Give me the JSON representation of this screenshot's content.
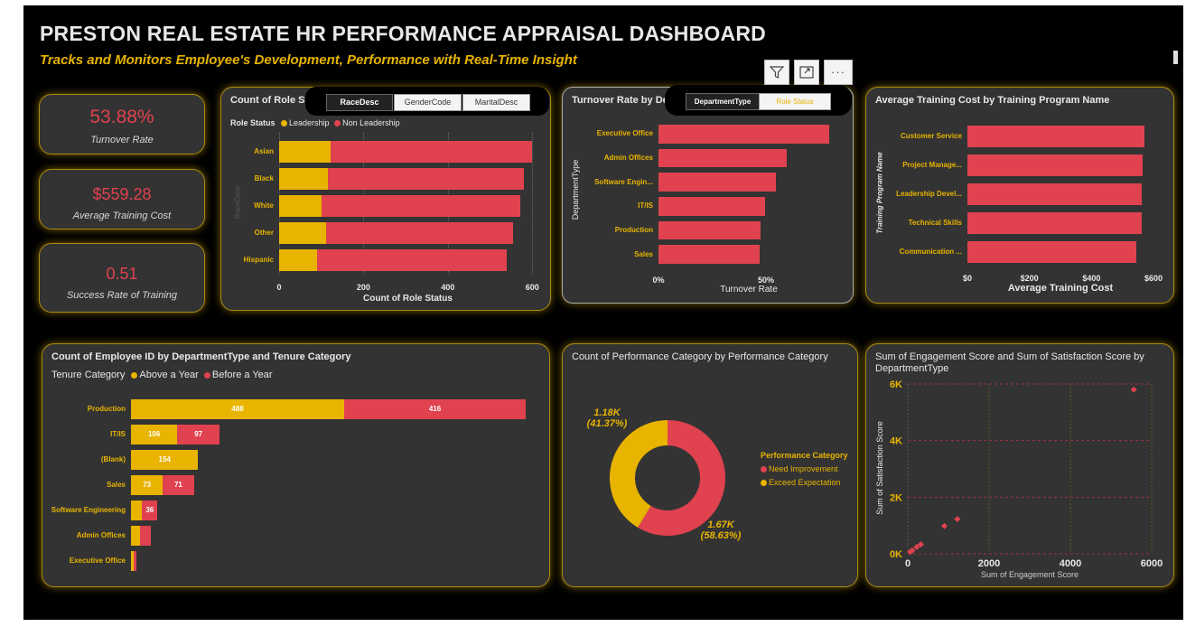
{
  "header": {
    "title": "PRESTON REAL ESTATE HR PERFORMANCE APPRAISAL DASHBOARD",
    "subtitle": "Tracks and Monitors Employee's Development, Performance  with Real-Time Insight"
  },
  "colors": {
    "gold": "#e8b400",
    "red": "#e0424f",
    "card": "#333333"
  },
  "kpis": [
    {
      "value": "53.88%",
      "label": "Turnover Rate"
    },
    {
      "value": "$559.28",
      "label": "Average Training Cost"
    },
    {
      "value": "0.51",
      "label": "Success Rate of Training"
    }
  ],
  "visual_header_icons": [
    "filter-icon",
    "focus-mode-icon",
    "more-options-icon"
  ],
  "more_options_glyph": "···",
  "chart_data": [
    {
      "id": "role_status",
      "type": "bar",
      "orientation": "horizontal",
      "stacked": true,
      "title": "Count of Role Status by RaceDesc",
      "title_visible": "Count of Role Stat",
      "legend_title": "Role Status",
      "tabs": [
        "RaceDesc",
        "GenderCode",
        "MaritalDesc"
      ],
      "ylabel": "RaceDesc",
      "xlabel": "Count of Role Status",
      "categories": [
        "Asian",
        "Black",
        "White",
        "Other",
        "Hispanic"
      ],
      "series": [
        {
          "name": "Leadership",
          "values": [
            123,
            116,
            101,
            112,
            90
          ]
        },
        {
          "name": "Non Leadership",
          "values": [
            477,
            464,
            470,
            442,
            449
          ]
        }
      ],
      "xticks": [
        "0",
        "200",
        "400",
        "600"
      ],
      "xlim": [
        0,
        610
      ]
    },
    {
      "id": "turnover",
      "type": "bar",
      "orientation": "horizontal",
      "title": "Turnover Rate by DepartmentType",
      "title_visible": "Turnover Rate by Dep",
      "tabs": [
        "DepartmentType",
        "Role Status"
      ],
      "ylabel": "DepartmentType",
      "xlabel": "Turnover Rate",
      "categories": [
        "Executive Office",
        "Admin Offices",
        "Software Engin...",
        "IT/IS",
        "Production",
        "Sales"
      ],
      "values": [
        0.795,
        0.595,
        0.545,
        0.495,
        0.475,
        0.47
      ],
      "xticks": [
        "0%",
        "50%"
      ],
      "xlim": [
        0,
        0.84
      ]
    },
    {
      "id": "training_cost",
      "type": "bar",
      "orientation": "horizontal",
      "title": "Average Training Cost by Training Program Name",
      "ylabel": "Training Program Name",
      "xlabel": "Average Training Cost",
      "categories": [
        "Customer Service",
        "Project Manage...",
        "Leadership Devel...",
        "Technical Skills",
        "Communication ..."
      ],
      "values": [
        571,
        564,
        562,
        562,
        546
      ],
      "xticks": [
        "$0",
        "$200",
        "$400",
        "$600"
      ],
      "xlim": [
        0,
        600
      ]
    },
    {
      "id": "tenure",
      "type": "bar",
      "orientation": "horizontal",
      "stacked": true,
      "title": "Count of Employee ID by DepartmentType and Tenure Category",
      "legend_title": "Tenure Category",
      "categories": [
        "Production",
        "IT/IS",
        "(Blank)",
        "Sales",
        "Software Engineering",
        "Admin Offices",
        "Executive Office"
      ],
      "series": [
        {
          "name": "Above a Year",
          "values": [
            488,
            106,
            154,
            73,
            25,
            20,
            6
          ]
        },
        {
          "name": "Before a Year",
          "values": [
            416,
            97,
            0,
            71,
            36,
            26,
            6
          ]
        }
      ],
      "labels": [
        [
          "488",
          "416"
        ],
        [
          "106",
          "97"
        ],
        [
          "154",
          ""
        ],
        [
          "73",
          "71"
        ],
        [
          "",
          "36"
        ],
        [
          "",
          ""
        ],
        [
          "",
          ""
        ]
      ],
      "xlim": [
        0,
        910
      ]
    },
    {
      "id": "performance",
      "type": "pie",
      "donut": true,
      "title": "Count of Performance Category by Performance Category",
      "legend_title": "Performance Category",
      "categories": [
        "Need Improvement",
        "Exceed Expectation"
      ],
      "values": [
        1670,
        1180
      ],
      "percent": [
        58.63,
        41.37
      ],
      "labels": [
        {
          "value": "1.67K",
          "pct": "(58.63%)"
        },
        {
          "value": "1.18K",
          "pct": "(41.37%)"
        }
      ]
    },
    {
      "id": "engagement",
      "type": "scatter",
      "title": "Sum of Engagement Score and Sum of Satisfaction Score by DepartmentType",
      "xlabel": "Sum of Engagement Score",
      "ylabel": "Sum of Satisfaction Score",
      "xticks": [
        "0",
        "2000",
        "4000",
        "6000"
      ],
      "yticks": [
        "6K",
        "4K",
        "2K",
        "0K"
      ],
      "xlim": [
        0,
        6000
      ],
      "ylim": [
        0,
        6000
      ],
      "points": [
        {
          "x": 5560,
          "y": 5800
        },
        {
          "x": 1220,
          "y": 1230
        },
        {
          "x": 900,
          "y": 980
        },
        {
          "x": 320,
          "y": 330
        },
        {
          "x": 220,
          "y": 240
        },
        {
          "x": 110,
          "y": 120
        },
        {
          "x": 60,
          "y": 70
        }
      ]
    }
  ]
}
